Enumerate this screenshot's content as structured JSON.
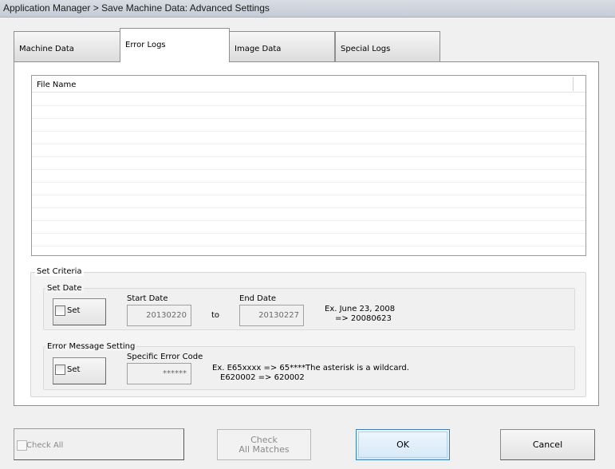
{
  "window": {
    "title": "Application Manager > Save Machine Data: Advanced Settings"
  },
  "tabs": [
    {
      "label": "Machine Data",
      "active": false
    },
    {
      "label": "Error Logs",
      "active": true
    },
    {
      "label": "Image Data",
      "active": false
    },
    {
      "label": "Special Logs",
      "active": false
    }
  ],
  "file_list": {
    "column_header": "File Name",
    "rows": []
  },
  "set_criteria": {
    "label": "Set Criteria",
    "set_date": {
      "label": "Set Date",
      "set_label": "Set",
      "start_label": "Start Date",
      "start_value": "20130220",
      "to_label": "to",
      "end_label": "End Date",
      "end_value": "20130227",
      "example_line1": "Ex. June 23, 2008",
      "example_line2": "=> 20080623"
    },
    "error_message": {
      "label": "Error Message Setting",
      "set_label": "Set",
      "code_label": "Specific Error Code",
      "code_value": "******",
      "example_line1": "Ex. E65xxxx => 65****",
      "example_line2": "E620002 => 620002",
      "wildcard_note": "The asterisk is a wildcard."
    }
  },
  "footer": {
    "check_all_label": "Check All",
    "check_matches_line1": "Check",
    "check_matches_line2": "All Matches",
    "ok_label": "OK",
    "cancel_label": "Cancel"
  }
}
